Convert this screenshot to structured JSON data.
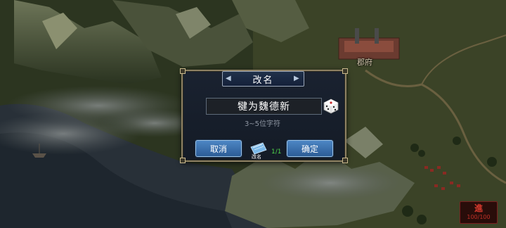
{
  "map": {
    "fort_label": "郡府"
  },
  "dialog": {
    "title": "改名",
    "name_value": "犍为魏德新",
    "hint": "3~5位字符",
    "cancel_label": "取消",
    "confirm_label": "确定",
    "ticket_label": "改名",
    "ticket_count": "1/1"
  },
  "advance_button": {
    "char": "進",
    "sub": "100/100"
  },
  "icons": {
    "dice": "dice-icon",
    "ticket": "rename-ticket-icon"
  },
  "colors": {
    "button_blue": "#3a70b0",
    "count_green": "#4fd64a",
    "advance_red": "#d93a2e",
    "frame_gold": "#8e8163"
  }
}
